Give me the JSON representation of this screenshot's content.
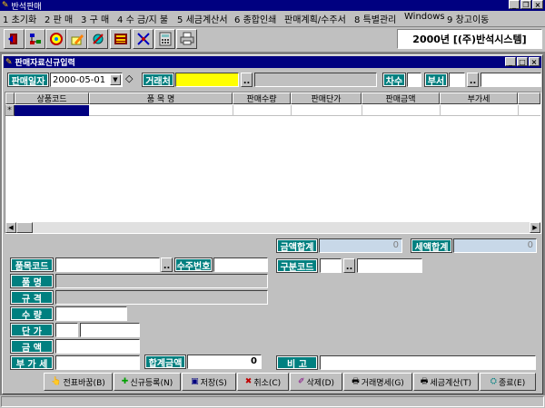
{
  "app": {
    "title": "반석판매"
  },
  "menu": [
    {
      "key": "1",
      "label": "초기화"
    },
    {
      "key": "2",
      "label": "판 매"
    },
    {
      "key": "3",
      "label": "구 매"
    },
    {
      "key": "4",
      "label": "수 금/지 불"
    },
    {
      "key": "5",
      "label": "세금계산서"
    },
    {
      "key": "6",
      "label": "종합인쇄"
    },
    {
      "key": "",
      "label": "판매계획/수주서"
    },
    {
      "key": "8",
      "label": "특별관리"
    },
    {
      "key": "",
      "label": "Windows"
    },
    {
      "key": "9",
      "label": "창고이동"
    }
  ],
  "toolbar": {
    "company": "2000년 [(주)반석시스템]",
    "buttons": [
      "exit-door-icon",
      "network-icon",
      "globe-icon",
      "pencil-note-icon",
      "gear-edit-icon",
      "abacus-icon",
      "chart-icon",
      "calculator-icon",
      "printer-icon"
    ]
  },
  "child": {
    "title": "판매자료신규입력",
    "controls": {
      "min": "_",
      "max": "□",
      "close": "×"
    }
  },
  "header": {
    "date_label": "판매일자",
    "date_value": "2000-05-01",
    "client_label": "거래처",
    "client_value": "",
    "browse": "..",
    "seq_label": "차수",
    "dept_label": "부서"
  },
  "grid": {
    "row_marker": "*",
    "columns": [
      "상품코드",
      "품 목 명",
      "판매수량",
      "판매단가",
      "판매금액",
      "부가세"
    ]
  },
  "totals": {
    "amount_label": "금액합계",
    "amount_value": "0",
    "tax_label": "세액합계",
    "tax_value": "0"
  },
  "detail": {
    "code_label": "품목코드",
    "order_label": "수주번호",
    "class_label": "구분코드",
    "name_label": "품 명",
    "spec_label": "규 격",
    "qty_label": "수 량",
    "price_label": "단 가",
    "amount_label": "금 액",
    "vat_label": "부 가 세",
    "total_label": "합계금액",
    "total_value": "0",
    "memo_label": "비 고"
  },
  "buttons": [
    {
      "name": "voucher-button",
      "icon": "voucher-icon",
      "label": "전표바꿈(B)"
    },
    {
      "name": "new-button",
      "icon": "new-record-icon",
      "label": "신규등록(N)"
    },
    {
      "name": "save-button",
      "icon": "floppy-icon",
      "label": "저장(S)"
    },
    {
      "name": "cancel-button",
      "icon": "cancel-x-icon",
      "label": "취소(C)"
    },
    {
      "name": "delete-button",
      "icon": "eraser-icon",
      "label": "삭제(D)"
    },
    {
      "name": "statement-button",
      "icon": "printer-icon",
      "label": "거래명세(G)"
    },
    {
      "name": "invoice-button",
      "icon": "printer-icon",
      "label": "세금계산(T)"
    },
    {
      "name": "exit-button",
      "icon": "network-icon",
      "label": "종료(E)"
    }
  ]
}
